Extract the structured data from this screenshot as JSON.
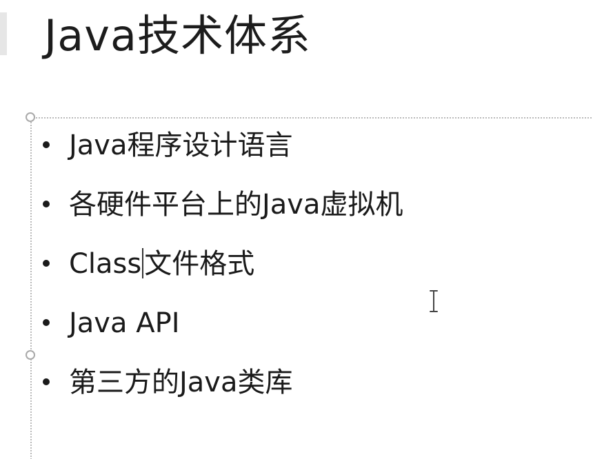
{
  "slide": {
    "title": "Java技术体系",
    "bullets": [
      "Java程序设计语言",
      "各硬件平台上的Java虚拟机",
      {
        "before_caret": "Class",
        "after_caret": "文件格式"
      },
      "Java API",
      "第三方的Java类库"
    ]
  },
  "icons": {
    "text_cursor": "ibeam-cursor-icon",
    "bullet": "bullet-dot-icon",
    "resize_handle": "resize-handle-icon"
  },
  "colors": {
    "text": "#1a1a1a",
    "placeholder_border": "#b9b9b9",
    "background": "#ffffff"
  }
}
